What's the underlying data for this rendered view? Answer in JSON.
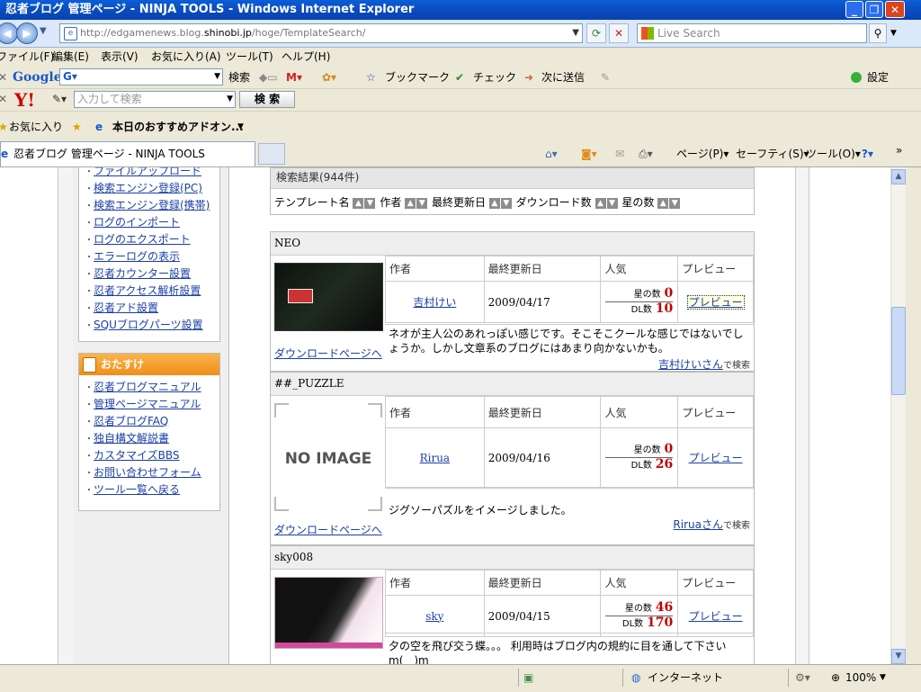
{
  "window": {
    "title": "忍者ブログ 管理ページ - NINJA TOOLS - Windows Internet Explorer",
    "min_label": "_",
    "max_label": "❐",
    "close_label": "✕"
  },
  "address": {
    "url_pre": "http://edgamenews.blog.",
    "url_host": "shinobi.jp",
    "url_post": "/hoge/TemplateSearch/",
    "search_placeholder": "Live Search"
  },
  "menu": [
    "ファイル(F)",
    "編集(E)",
    "表示(V)",
    "お気に入り(A)",
    "ツール(T)",
    "ヘルプ(H)"
  ],
  "googlebar": {
    "logo": "Google",
    "search_btn": "検索",
    "bookmark": "ブックマーク",
    "check": "チェック",
    "sendto": "次に送信",
    "settings": "設定"
  },
  "yahoobar": {
    "logo": "Y!",
    "placeholder": "入力して検索",
    "search_btn": "検 索"
  },
  "favbar": {
    "favorites": "お気に入り",
    "addons": "本日のおすすめアドオン..."
  },
  "tab": {
    "title": "忍者ブログ 管理ページ - NINJA TOOLS"
  },
  "commandbar": {
    "page": "ページ(P)",
    "safety": "セーフティ(S)",
    "tools": "ツール(O)"
  },
  "sidebar": {
    "box1_items": [
      "ファイルアップロード",
      "検索エンジン登録(PC)",
      "検索エンジン登録(携帯)",
      "ログのインポート",
      "ログのエクスポート",
      "エラーログの表示",
      "忍者カウンター設置",
      "忍者アクセス解析設置",
      "忍者アド設置",
      "SQUブログパーツ設置"
    ],
    "box2_title": "おたすけ",
    "box2_items": [
      "忍者ブログマニュアル",
      "管理ページマニュアル",
      "忍者ブログFAQ",
      "独自構文解説書",
      "カスタマイズBBS",
      "お問い合わせフォーム",
      "ツール一覧へ戻る"
    ]
  },
  "search": {
    "results": "検索結果(944件)",
    "sort_template": "テンプレート名",
    "sort_author": "作者",
    "sort_updated": "最終更新日",
    "sort_downloads": "ダウンロード数",
    "sort_stars": "星の数"
  },
  "table_headers": {
    "author": "作者",
    "updated": "最終更新日",
    "popularity": "人気",
    "preview": "プレビュー"
  },
  "labels": {
    "stars": "星の数",
    "dl": "DL数",
    "preview_link": "プレビュー",
    "download_link": "ダウンロードページへ",
    "search_suffix": "で検索",
    "no_image": "NO IMAGE"
  },
  "templates": [
    {
      "name": "NEO",
      "author": "吉村けい",
      "date": "2009/04/17",
      "stars": "0",
      "dl": "10",
      "desc": "ネオが主人公のあれっぽい感じです。そこそこクールな感じではないでしょうか。しかし文章系のブログにはあまり向かないかも。",
      "search_link": "吉村けいさん"
    },
    {
      "name": "##_PUZZLE",
      "author": "Rirua",
      "date": "2009/04/16",
      "stars": "0",
      "dl": "26",
      "desc": "ジグソーパズルをイメージしました。",
      "search_link": "Riruaさん"
    },
    {
      "name": "sky008",
      "author": "sky",
      "date": "2009/04/15",
      "stars": "46",
      "dl": "170",
      "desc": "夕の空を飛び交う蝶。。。 利用時はブログ内の規約に目を通して下さい m(__)m"
    }
  ],
  "status": {
    "zone": "インターネット",
    "zoom": "100%"
  }
}
